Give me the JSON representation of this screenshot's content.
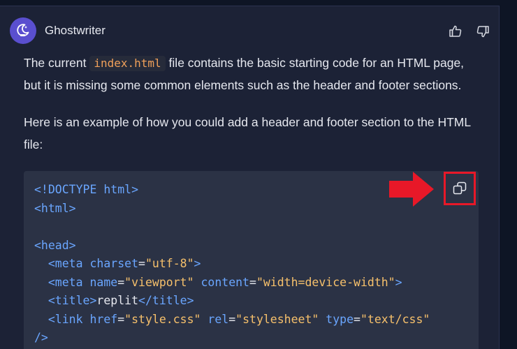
{
  "message": {
    "author": "Ghostwriter",
    "avatar_icon": "ghostwriter-logo-icon",
    "paragraph1": {
      "before": "The current ",
      "code": "index.html",
      "after": " file contains the basic starting code for an HTML page, but it is missing some common elements such as the header and footer sections."
    },
    "paragraph2": "Here is an example of how you could add a header and footer section to the HTML file:"
  },
  "feedback": {
    "thumbs_up_icon": "thumbs-up-icon",
    "thumbs_down_icon": "thumbs-down-icon"
  },
  "code_block": {
    "copy_icon": "copy-icon",
    "lines": [
      [
        {
          "t": "tag",
          "v": "<!DOCTYPE html>"
        }
      ],
      [
        {
          "t": "tag",
          "v": "<html>"
        }
      ],
      [],
      [
        {
          "t": "tag",
          "v": "<head>"
        }
      ],
      [
        {
          "t": "txt",
          "v": "  "
        },
        {
          "t": "tag",
          "v": "<meta"
        },
        {
          "t": "txt",
          "v": " "
        },
        {
          "t": "attr",
          "v": "charset"
        },
        {
          "t": "txt",
          "v": "="
        },
        {
          "t": "str",
          "v": "\"utf-8\""
        },
        {
          "t": "tag",
          "v": ">"
        }
      ],
      [
        {
          "t": "txt",
          "v": "  "
        },
        {
          "t": "tag",
          "v": "<meta"
        },
        {
          "t": "txt",
          "v": " "
        },
        {
          "t": "attr",
          "v": "name"
        },
        {
          "t": "txt",
          "v": "="
        },
        {
          "t": "str",
          "v": "\"viewport\""
        },
        {
          "t": "txt",
          "v": " "
        },
        {
          "t": "attr",
          "v": "content"
        },
        {
          "t": "txt",
          "v": "="
        },
        {
          "t": "str",
          "v": "\"width=device-width\""
        },
        {
          "t": "tag",
          "v": ">"
        }
      ],
      [
        {
          "t": "txt",
          "v": "  "
        },
        {
          "t": "tag",
          "v": "<title>"
        },
        {
          "t": "txt",
          "v": "replit"
        },
        {
          "t": "tag",
          "v": "</title>"
        }
      ],
      [
        {
          "t": "txt",
          "v": "  "
        },
        {
          "t": "tag",
          "v": "<link"
        },
        {
          "t": "txt",
          "v": " "
        },
        {
          "t": "attr",
          "v": "href"
        },
        {
          "t": "txt",
          "v": "="
        },
        {
          "t": "str",
          "v": "\"style.css\""
        },
        {
          "t": "txt",
          "v": " "
        },
        {
          "t": "attr",
          "v": "rel"
        },
        {
          "t": "txt",
          "v": "="
        },
        {
          "t": "str",
          "v": "\"stylesheet\""
        },
        {
          "t": "txt",
          "v": " "
        },
        {
          "t": "attr",
          "v": "type"
        },
        {
          "t": "txt",
          "v": "="
        },
        {
          "t": "str",
          "v": "\"text/css\""
        }
      ],
      [
        {
          "t": "tag",
          "v": "/>"
        }
      ]
    ]
  },
  "annotation": {
    "arrow_color": "#e81828",
    "highlight_color": "#e81828"
  }
}
